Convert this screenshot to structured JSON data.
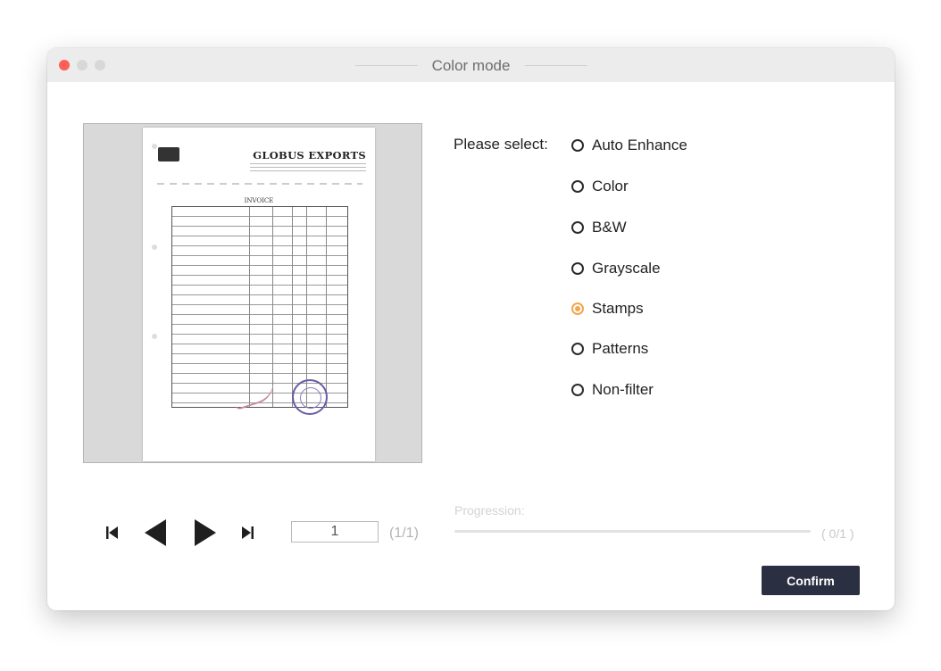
{
  "window": {
    "title": "Color mode"
  },
  "preview": {
    "doc_brand": "GLOBUS EXPORTS",
    "doc_heading": "INVOICE"
  },
  "options": {
    "label": "Please select:",
    "items": [
      {
        "label": "Auto Enhance",
        "selected": false
      },
      {
        "label": "Color",
        "selected": false
      },
      {
        "label": "B&W",
        "selected": false
      },
      {
        "label": "Grayscale",
        "selected": false
      },
      {
        "label": "Stamps",
        "selected": true
      },
      {
        "label": "Patterns",
        "selected": false
      },
      {
        "label": "Non-filter",
        "selected": false
      }
    ]
  },
  "pager": {
    "current_page": "1",
    "page_count": "(1/1)"
  },
  "progress": {
    "label": "Progression:",
    "count": "( 0/1 )",
    "fraction": 0
  },
  "buttons": {
    "confirm": "Confirm"
  },
  "colors": {
    "selected_radio": "#f5a54a",
    "confirm_bg": "#2b2f42",
    "close_button": "#fe5f57"
  }
}
